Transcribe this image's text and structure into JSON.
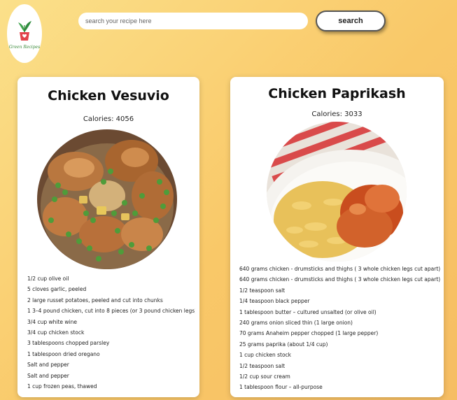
{
  "logo": {
    "text": "Green Recipes",
    "icon": "plant-pot-logo"
  },
  "search": {
    "placeholder": "search your recipe here",
    "value": "",
    "button_label": "search"
  },
  "colors": {
    "background_start": "#fbe08a",
    "background_end": "#f6bd63",
    "card": "#ffffff"
  },
  "recipes": [
    {
      "title": "Chicken Vesuvio",
      "calories": "Calories: 4056",
      "image": "chicken-vesuvio-photo",
      "ingredients": [
        "1/2 cup olive oil",
        "5 cloves garlic, peeled",
        "2 large russet potatoes, peeled and cut into chunks",
        "1 3–4 pound chicken, cut into 8 pieces (or 3 pound chicken legs)",
        "3/4 cup white wine",
        "3/4 cup chicken stock",
        "3 tablespoons chopped parsley",
        "1 tablespoon dried oregano",
        "Salt and pepper",
        "Salt and pepper",
        "1 cup frozen peas, thawed"
      ]
    },
    {
      "title": "Chicken Paprikash",
      "calories": "Calories: 3033",
      "image": "chicken-paprikash-photo",
      "ingredients": [
        "640 grams chicken - drumsticks and thighs ( 3 whole chicken legs cut apart)",
        "640 grams chicken - drumsticks and thighs ( 3 whole chicken legs cut apart)",
        "1/2 teaspoon salt",
        "1/4 teaspoon black pepper",
        "1 tablespoon butter – cultured unsalted (or olive oil)",
        "240 grams onion sliced thin (1 large onion)",
        "70 grams Anaheim pepper chopped (1 large pepper)",
        "25 grams paprika (about 1/4 cup)",
        "1 cup chicken stock",
        "1/2 teaspoon salt",
        "1/2 cup sour cream",
        "1 tablespoon flour – all-purpose"
      ]
    }
  ]
}
